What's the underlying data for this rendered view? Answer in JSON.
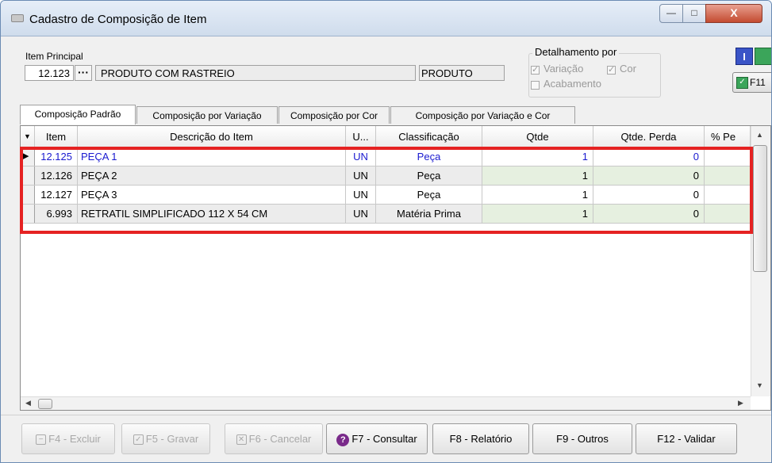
{
  "window": {
    "title": "Cadastro de Composição de Item",
    "min_glyph": "—",
    "max_glyph": "□",
    "close_glyph": "X"
  },
  "item_principal": {
    "label": "Item Principal",
    "code": "12.123",
    "lookup_glyph": "···",
    "description": "PRODUTO COM RASTREIO",
    "type": "PRODUTO"
  },
  "detalhamento": {
    "legend": "Detalhamento por",
    "variacao": {
      "label": "Variação",
      "checked": true
    },
    "cor": {
      "label": "Cor",
      "checked": true
    },
    "acabamento": {
      "label": "Acabamento",
      "checked": false
    }
  },
  "right_buttons": {
    "info_glyph": "I",
    "f11_label": "F11"
  },
  "tabs": [
    "Composição Padrão",
    "Composição por Variação",
    "Composição por Cor",
    "Composição por Variação e Cor"
  ],
  "grid": {
    "columns": [
      "Item",
      "Descrição do Item",
      "U...",
      "Classificação",
      "Qtde",
      "Qtde. Perda",
      "% Pe"
    ],
    "rows": [
      {
        "item": "12.125",
        "descricao": "PEÇA 1",
        "unidade": "UN",
        "classificacao": "Peça",
        "qtde": "1",
        "perda": "0"
      },
      {
        "item": "12.126",
        "descricao": "PEÇA 2",
        "unidade": "UN",
        "classificacao": "Peça",
        "qtde": "1",
        "perda": "0"
      },
      {
        "item": "12.127",
        "descricao": "PEÇA 3",
        "unidade": "UN",
        "classificacao": "Peça",
        "qtde": "1",
        "perda": "0"
      },
      {
        "item": "6.993",
        "descricao": "RETRATIL SIMPLIFICADO 112 X 54 CM",
        "unidade": "UN",
        "classificacao": "Matéria Prima",
        "qtde": "1",
        "perda": "0"
      }
    ]
  },
  "buttons": {
    "excluir": "F4 - Excluir",
    "gravar": "F5 - Gravar",
    "cancelar": "F6 - Cancelar",
    "consultar": "F7 - Consultar",
    "relatorio": "F8 - Relatório",
    "outros": "F9 - Outros",
    "validar": "F12 - Validar"
  },
  "colors": {
    "highlight": "#e52222",
    "selected_text": "#1a1ad0",
    "green_cell": "#e6f0e0"
  }
}
